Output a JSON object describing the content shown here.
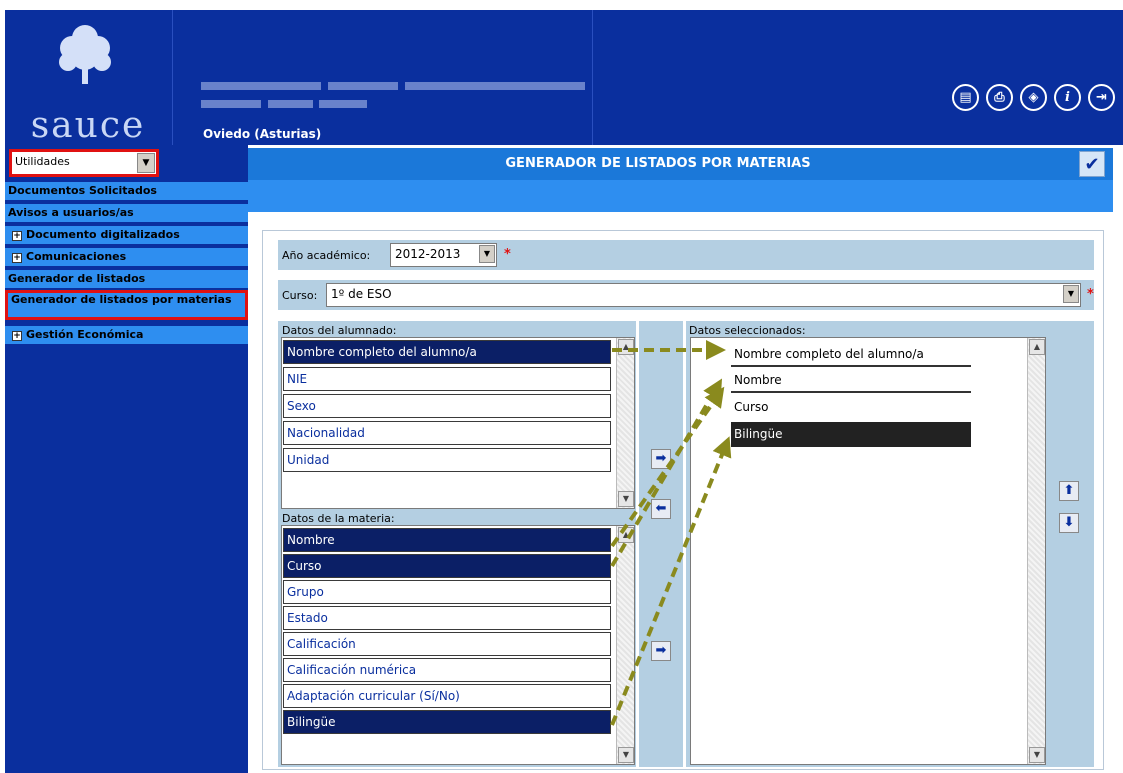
{
  "header": {
    "logo_text": "sauce",
    "city": "Oviedo (Asturias)",
    "icons": [
      "document-icon",
      "print-icon",
      "navigation-icon",
      "info-icon",
      "exit-icon"
    ]
  },
  "title": {
    "text": "GENERADOR DE LISTADOS POR MATERIAS",
    "confirm_icon": "checkmark-icon"
  },
  "sidebar": {
    "module_select": "Utilidades",
    "items": [
      {
        "label": "Documentos Solicitados",
        "expandable": false
      },
      {
        "label": "Avisos a usuarios/as",
        "expandable": false
      },
      {
        "label": "Documento digitalizados",
        "expandable": true
      },
      {
        "label": "Comunicaciones",
        "expandable": true
      },
      {
        "label": "Generador de listados",
        "expandable": false
      },
      {
        "label": "Generador de listados por materias",
        "expandable": false,
        "highlighted": true
      },
      {
        "label": "Gestión Económica",
        "expandable": true
      }
    ]
  },
  "form": {
    "year_label": "Año académico:",
    "year_value": "2012-2013",
    "course_label": "Curso:",
    "course_value": "1º de ESO",
    "required_mark": "*"
  },
  "student_fields": {
    "label": "Datos del alumnado:",
    "items": [
      {
        "text": "Nombre completo del alumno/a",
        "selected": true
      },
      {
        "text": "NIE",
        "selected": false
      },
      {
        "text": "Sexo",
        "selected": false
      },
      {
        "text": "Nacionalidad",
        "selected": false
      },
      {
        "text": "Unidad",
        "selected": false
      }
    ]
  },
  "subject_fields": {
    "label": "Datos de la materia:",
    "items": [
      {
        "text": "Nombre",
        "selected": true
      },
      {
        "text": "Curso",
        "selected": true
      },
      {
        "text": "Grupo",
        "selected": false
      },
      {
        "text": "Estado",
        "selected": false
      },
      {
        "text": "Calificación",
        "selected": false
      },
      {
        "text": "Calificación numérica",
        "selected": false
      },
      {
        "text": "Adaptación curricular (Sí/No)",
        "selected": false
      },
      {
        "text": "Bilingüe",
        "selected": true
      }
    ]
  },
  "selected_fields": {
    "label": "Datos seleccionados:",
    "items": [
      {
        "text": "Nombre completo del alumno/a",
        "selected": false
      },
      {
        "text": "Nombre",
        "selected": false
      },
      {
        "text": "Curso",
        "selected": false
      },
      {
        "text": "Bilingüe",
        "selected": true
      }
    ]
  },
  "colors": {
    "header_bg": "#0a2f9e",
    "title_bg": "#1b78d9",
    "highlight": "#e01111",
    "annotation_arrow": "#8a8a1e"
  }
}
